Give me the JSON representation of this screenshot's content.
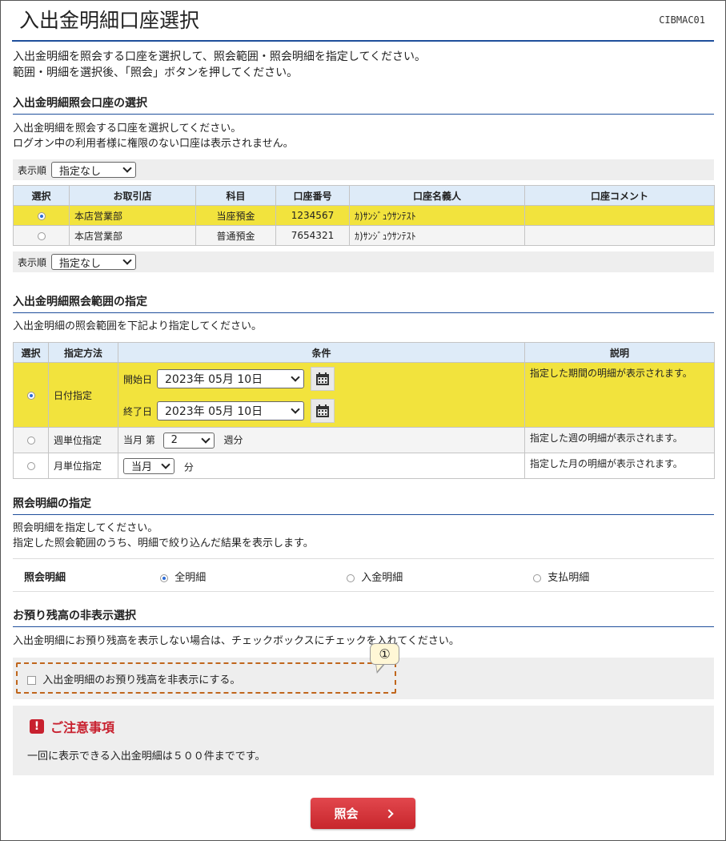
{
  "page": {
    "title": "入出金明細口座選択",
    "screen_id": "CIBMAC01",
    "intro_lines": [
      "入出金明細を照会する口座を選択して、照会範囲・照会明細を指定してください。",
      "範囲・明細を選択後、「照会」ボタンを押してください。"
    ]
  },
  "account_section": {
    "heading": "入出金明細照会口座の選択",
    "desc_lines": [
      "入出金明細を照会する口座を選択してください。",
      "ログオン中の利用者様に権限のない口座は表示されません。"
    ],
    "sort_label": "表示順",
    "sort_value": "指定なし",
    "columns": [
      "選択",
      "お取引店",
      "科目",
      "口座番号",
      "口座名義人",
      "口座コメント"
    ],
    "rows": [
      {
        "selected": true,
        "branch": "本店営業部",
        "type": "当座預金",
        "number": "1234567",
        "holder": "ｶ)ｻﾝｼﾞｭｳｻﾝﾃｽﾄ",
        "comment": ""
      },
      {
        "selected": false,
        "branch": "本店営業部",
        "type": "普通預金",
        "number": "7654321",
        "holder": "ｶ)ｻﾝｼﾞｭｳｻﾝﾃｽﾄ",
        "comment": ""
      }
    ]
  },
  "range_section": {
    "heading": "入出金明細照会範囲の指定",
    "desc": "入出金明細の照会範囲を下記より指定してください。",
    "columns": [
      "選択",
      "指定方法",
      "条件",
      "説明"
    ],
    "date": {
      "method": "日付指定",
      "start_label": "開始日",
      "start_value": "2023年 05月 10日",
      "end_label": "終了日",
      "end_value": "2023年 05月 10日",
      "note": "指定した期間の明細が表示されます。"
    },
    "week": {
      "method": "週単位指定",
      "prefix": "当月 第",
      "value": "2",
      "suffix": "週分",
      "note": "指定した週の明細が表示されます。"
    },
    "month": {
      "method": "月単位指定",
      "value": "当月",
      "suffix": "分",
      "note": "指定した月の明細が表示されます。"
    }
  },
  "detail_section": {
    "heading": "照会明細の指定",
    "desc_lines": [
      "照会明細を指定してください。",
      "指定した照会範囲のうち、明細で絞り込んだ結果を表示します。"
    ],
    "label": "照会明細",
    "options": [
      "全明細",
      "入金明細",
      "支払明細"
    ]
  },
  "balance_section": {
    "heading": "お預り残高の非表示選択",
    "desc": "入出金明細にお預り残高を表示しない場合は、チェックボックスにチェックを入れてください。",
    "checkbox_label": "入出金明細のお預り残高を非表示にする。",
    "callout": "①"
  },
  "notice": {
    "icon": "!",
    "title": "ご注意事項",
    "text": "一回に表示できる入出金明細は５００件までです。"
  },
  "submit_label": "照会"
}
